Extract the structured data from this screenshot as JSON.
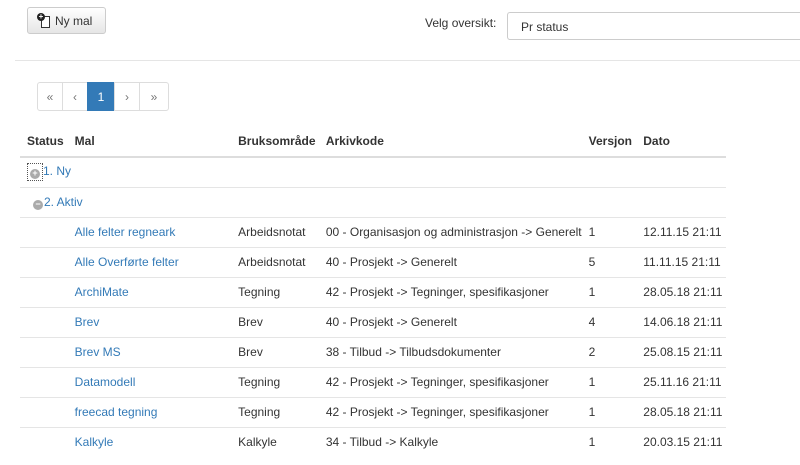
{
  "toolbar": {
    "new_template_label": "Ny mal"
  },
  "overview": {
    "label": "Velg oversikt:",
    "selected": "Pr status"
  },
  "pagination": {
    "first": "«",
    "prev": "‹",
    "current": "1",
    "next": "›",
    "last": "»"
  },
  "table": {
    "headers": [
      "Status",
      "Mal",
      "Bruksområde",
      "Arkivkode",
      "Versjon",
      "Dato"
    ],
    "groups": [
      {
        "label": "1. Ny",
        "icon": "+"
      },
      {
        "label": "2. Aktiv",
        "icon": "−"
      }
    ],
    "rows": [
      {
        "mal": "Alle felter regneark",
        "bruk": "Arbeidsnotat",
        "arkiv": "00 - Organisasjon og administrasjon -> Generelt",
        "versjon": "1",
        "dato": "12.11.15 21:11"
      },
      {
        "mal": "Alle Overførte felter",
        "bruk": "Arbeidsnotat",
        "arkiv": "40 - Prosjekt -> Generelt",
        "versjon": "5",
        "dato": "11.11.15 21:11"
      },
      {
        "mal": "ArchiMate",
        "bruk": "Tegning",
        "arkiv": "42 - Prosjekt -> Tegninger, spesifikasjoner",
        "versjon": "1",
        "dato": "28.05.18 21:11"
      },
      {
        "mal": "Brev",
        "bruk": "Brev",
        "arkiv": "40 - Prosjekt -> Generelt",
        "versjon": "4",
        "dato": "14.06.18 21:11"
      },
      {
        "mal": "Brev MS",
        "bruk": "Brev",
        "arkiv": "38 - Tilbud -> Tilbudsdokumenter",
        "versjon": "2",
        "dato": "25.08.15 21:11"
      },
      {
        "mal": "Datamodell",
        "bruk": "Tegning",
        "arkiv": "42 - Prosjekt -> Tegninger, spesifikasjoner",
        "versjon": "1",
        "dato": "25.11.16 21:11"
      },
      {
        "mal": "freecad tegning",
        "bruk": "Tegning",
        "arkiv": "42 - Prosjekt -> Tegninger, spesifikasjoner",
        "versjon": "1",
        "dato": "28.05.18 21:11"
      },
      {
        "mal": "Kalkyle",
        "bruk": "Kalkyle",
        "arkiv": "34 - Tilbud -> Kalkyle",
        "versjon": "1",
        "dato": "20.03.15 21:11"
      }
    ]
  }
}
